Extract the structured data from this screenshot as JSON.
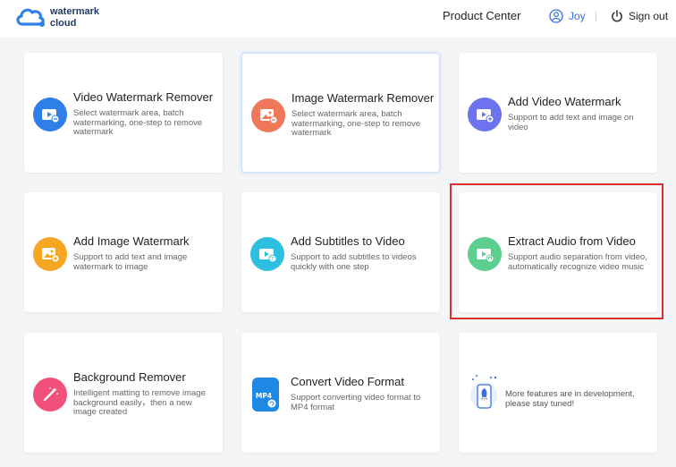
{
  "header": {
    "logo_text": "watermark\ncloud",
    "product_center": "Product Center",
    "user_name": "Joy",
    "sign_out": "Sign out"
  },
  "cards": [
    {
      "title": "Video Watermark Remover",
      "desc": "Select watermark area, batch watermarking, one-step to remove watermark",
      "icon": "video-icon"
    },
    {
      "title": "Image Watermark Remover",
      "desc": "Select watermark area, batch watermarking, one-step to remove watermark",
      "icon": "image-icon"
    },
    {
      "title": "Add Video Watermark",
      "desc": "Support to add text and image on video",
      "icon": "video-add-icon"
    },
    {
      "title": "Add Image Watermark",
      "desc": "Support to add text and image watermark to image",
      "icon": "image-add-icon"
    },
    {
      "title": "Add Subtitles to Video",
      "desc": "Support to add subtitles to videos quickly with one step",
      "icon": "subtitle-icon"
    },
    {
      "title": "Extract Audio from Video",
      "desc": "Support audio separation from video, automatically recognize video music",
      "icon": "audio-extract-icon"
    },
    {
      "title": "Background Remover",
      "desc": "Intelligent matting to remove image background easily，then a new image created",
      "icon": "magic-wand-icon"
    },
    {
      "title": "Convert Video Format",
      "desc": "Support converting video format to MP4 format",
      "icon": "mp4-file-icon",
      "icon_label": "MP4"
    }
  ],
  "more_features": "More features are in development, please stay tuned!",
  "colors": {
    "accent": "#3b6fe0",
    "highlight": "#d9302c",
    "video_remover": "#2f7fe8",
    "image_remover": "#f0785a",
    "video_add": "#6b73ee",
    "image_add": "#f5a623",
    "subtitle": "#2cbfe0",
    "audio": "#5ccf8f",
    "background": "#f0507a",
    "convert": "#1e88e5"
  }
}
